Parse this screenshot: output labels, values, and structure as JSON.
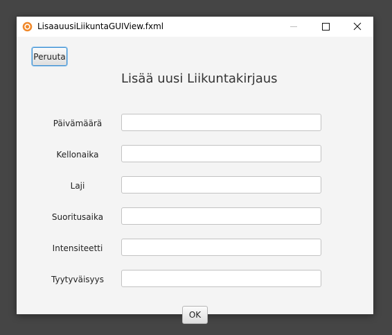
{
  "window": {
    "title": "LisaauusiLiikuntaGUIView.fxml"
  },
  "toolbar": {
    "cancel_label": "Peruuta"
  },
  "form": {
    "heading": "Lisää uusi Liikuntakirjaus",
    "fields": [
      {
        "label": "Päivämäärä",
        "value": ""
      },
      {
        "label": "Kellonaika",
        "value": ""
      },
      {
        "label": "Laji",
        "value": ""
      },
      {
        "label": "Suoritusaika",
        "value": ""
      },
      {
        "label": "Intensiteetti",
        "value": ""
      },
      {
        "label": "Tyytyväisyys",
        "value": ""
      }
    ],
    "ok_label": "OK"
  },
  "colors": {
    "focus_border": "#3c8fd1",
    "app_icon": "#f0892b"
  },
  "icons": {
    "app": "java-app-icon",
    "minimize": "minimize-icon",
    "maximize": "maximize-icon",
    "close": "close-icon"
  }
}
